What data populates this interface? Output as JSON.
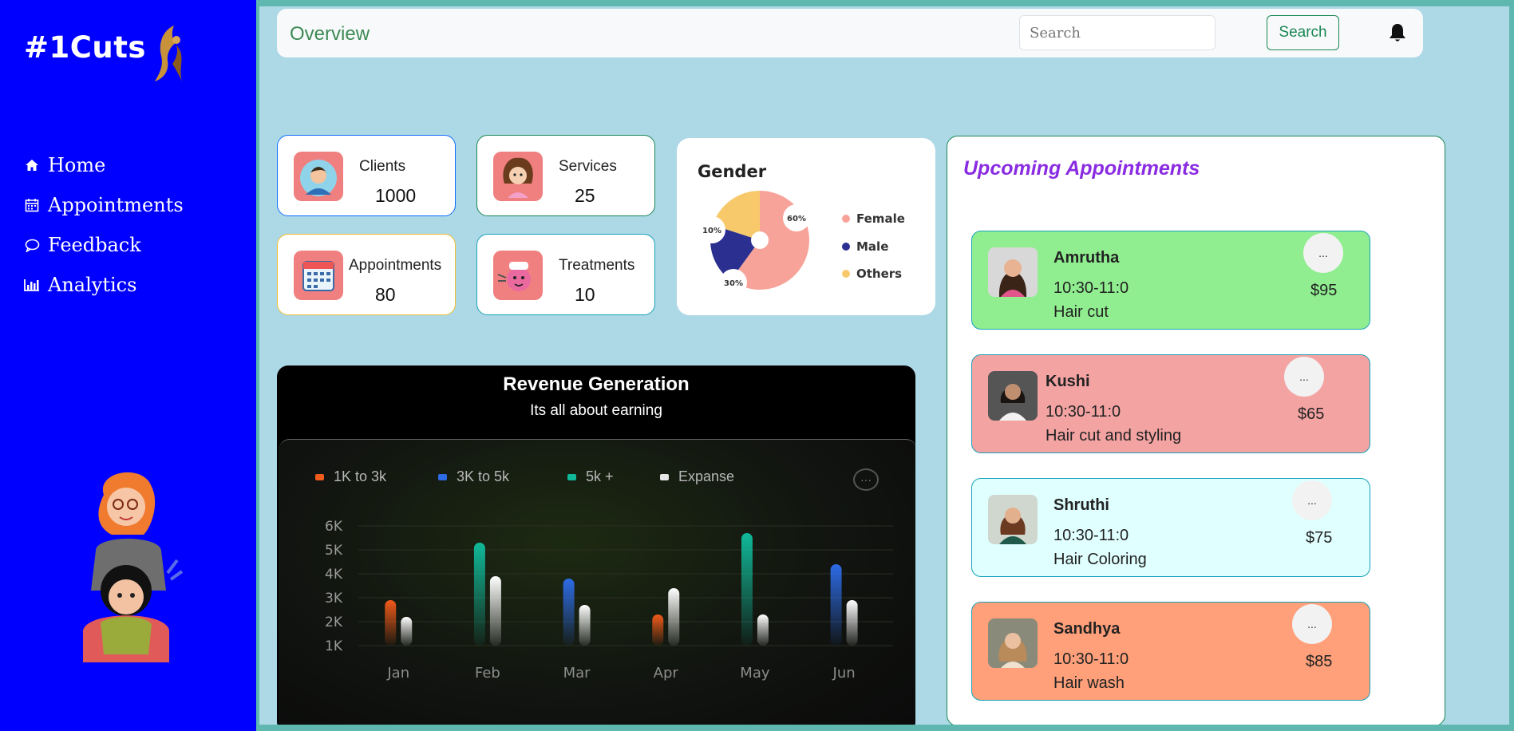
{
  "sidebar": {
    "brand": "#1Cuts",
    "items": [
      {
        "label": "Home",
        "icon": "home-icon"
      },
      {
        "label": "Appointments",
        "icon": "calendar-icon"
      },
      {
        "label": "Feedback",
        "icon": "comment-icon"
      },
      {
        "label": "Analytics",
        "icon": "bar-chart-icon"
      }
    ]
  },
  "header": {
    "title": "Overview",
    "search_placeholder": "Search",
    "search_button": "Search"
  },
  "stats": [
    {
      "label": "Clients",
      "value": "1000"
    },
    {
      "label": "Services",
      "value": "25"
    },
    {
      "label": "Appointments",
      "value": "80"
    },
    {
      "label": "Treatments",
      "value": "10"
    }
  ],
  "gender_chart": {
    "title": "Gender",
    "legend": [
      "Female",
      "Male",
      "Others"
    ],
    "percent_labels": [
      "60%",
      "30%",
      "10%"
    ],
    "colors": {
      "female": "#f8a39a",
      "male": "#2b2f8f",
      "others": "#f7c96b"
    }
  },
  "revenue": {
    "title": "Revenue Generation",
    "subtitle": "Its all about earning",
    "more": "···"
  },
  "chart_data": {
    "type": "bar",
    "categories": [
      "Jan",
      "Feb",
      "Mar",
      "Apr",
      "May",
      "Jun"
    ],
    "yticks": [
      "6K",
      "5K",
      "4K",
      "3K",
      "2K",
      "1K"
    ],
    "ylim": [
      1000,
      6000
    ],
    "series": [
      {
        "name": "1K to 3k",
        "color": "#f05a1a",
        "values": [
          2900,
          null,
          null,
          2300,
          null,
          null
        ]
      },
      {
        "name": "3K to 5k",
        "color": "#2d6be6",
        "values": [
          null,
          null,
          3800,
          null,
          null,
          4400
        ]
      },
      {
        "name": "5k +",
        "color": "#10b99a",
        "values": [
          null,
          5300,
          null,
          null,
          5700,
          null
        ]
      },
      {
        "name": "Expanse",
        "color": "#e6e6e6",
        "values": [
          2200,
          3900,
          2700,
          3400,
          2300,
          2900
        ]
      }
    ]
  },
  "appointments": {
    "title": "Upcoming Appointments",
    "more": "...",
    "items": [
      {
        "name": "Amrutha",
        "time": "10:30-11:0",
        "service": "Hair cut",
        "price": "$95",
        "color": "#90ee90"
      },
      {
        "name": "Kushi",
        "time": "10:30-11:0",
        "service": "Hair cut and styling",
        "price": "$65",
        "color": "#f4a3a3"
      },
      {
        "name": "Shruthi",
        "time": "10:30-11:0",
        "service": "Hair Coloring",
        "price": "$75",
        "color": "#e0ffff"
      },
      {
        "name": "Sandhya",
        "time": "10:30-11:0",
        "service": "Hair wash",
        "price": "$85",
        "color": "#ffa07a"
      }
    ]
  }
}
